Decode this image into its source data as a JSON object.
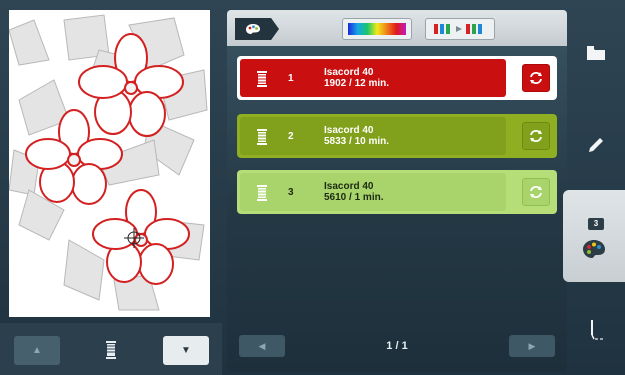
{
  "preview": {
    "alt": "Embroidery design preview: dogwood flowers"
  },
  "left_toolbar": {
    "up_label": "▲",
    "down_label": "▼"
  },
  "top_tabs": {
    "palette_icon": "palette-icon",
    "rainbow_icon": "color-spectrum-icon",
    "sort_icon": "color-sort-icon"
  },
  "threads": [
    {
      "index": "1",
      "name": "Isacord 40",
      "details": "1902 / 12 min.",
      "color": "#c90f10"
    },
    {
      "index": "2",
      "name": "Isacord 40",
      "details": "5833 / 10 min.",
      "color": "#81a01b"
    },
    {
      "index": "3",
      "name": "Isacord 40",
      "details": "5610 / 1 min.",
      "color": "#a8d46b"
    }
  ],
  "pager": {
    "prev": "◀",
    "next": "▶",
    "indicator": "1 / 1"
  },
  "sidebar": {
    "active_badge": "3"
  }
}
